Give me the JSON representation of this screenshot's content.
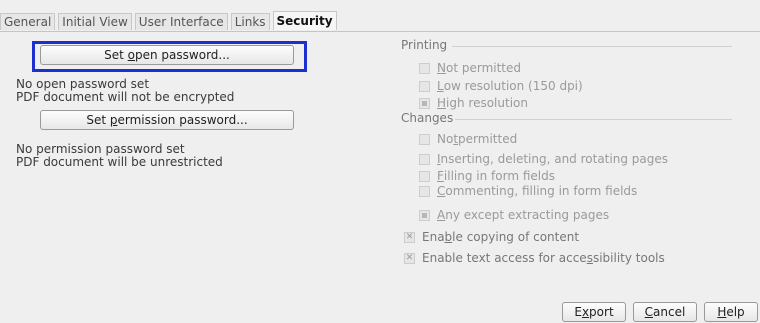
{
  "tabs": [
    {
      "label": "General",
      "active": false
    },
    {
      "label": "Initial View",
      "active": false
    },
    {
      "label": "User Interface",
      "active": false
    },
    {
      "label": "Links",
      "active": false
    },
    {
      "label": "Security",
      "active": true
    }
  ],
  "open_password": {
    "button_pre": "Set ",
    "button_mnemonic": "o",
    "button_post": "pen password...",
    "status_line1": "No open password set",
    "status_line2": "PDF document will not be encrypted"
  },
  "permission_password": {
    "button_pre": "Set ",
    "button_mnemonic": "p",
    "button_post": "ermission password...",
    "status_line1": "No permission password set",
    "status_line2": "PDF document will be unrestricted"
  },
  "printing": {
    "title": "Printing",
    "options": [
      {
        "pre": "",
        "mn": "N",
        "post": "ot permitted",
        "selected": false
      },
      {
        "pre": "",
        "mn": "L",
        "post": "ow resolution (150 dpi)",
        "selected": false
      },
      {
        "pre": "",
        "mn": "H",
        "post": "igh resolution",
        "selected": true
      }
    ]
  },
  "changes": {
    "title": "Changes",
    "options": [
      {
        "pre": "No",
        "mn": "t",
        "post": " permitted",
        "selected": false
      },
      {
        "pre": "",
        "mn": "I",
        "post": "nserting, deleting, and rotating pages",
        "selected": false
      },
      {
        "pre": "",
        "mn": "F",
        "post": "illing in form fields",
        "selected": false
      },
      {
        "pre": "",
        "mn": "C",
        "post": "ommenting, filling in form fields",
        "selected": false
      },
      {
        "pre": "",
        "mn": "A",
        "post": "ny except extracting pages",
        "selected": true
      }
    ]
  },
  "content": {
    "copy": {
      "pre": "Ena",
      "mn": "b",
      "post": "le copying of content",
      "checked": true,
      "check_glyph": "✕"
    },
    "access": {
      "pre": "Enable text access for acce",
      "mn": "s",
      "post": "sibility tools",
      "checked": true,
      "check_glyph": "✕"
    }
  },
  "footer": {
    "export": {
      "pre": "E",
      "mn": "x",
      "post": "port"
    },
    "cancel": {
      "pre": "",
      "mn": "C",
      "post": "ancel"
    },
    "help": {
      "pre": "",
      "mn": "H",
      "post": "elp"
    }
  }
}
